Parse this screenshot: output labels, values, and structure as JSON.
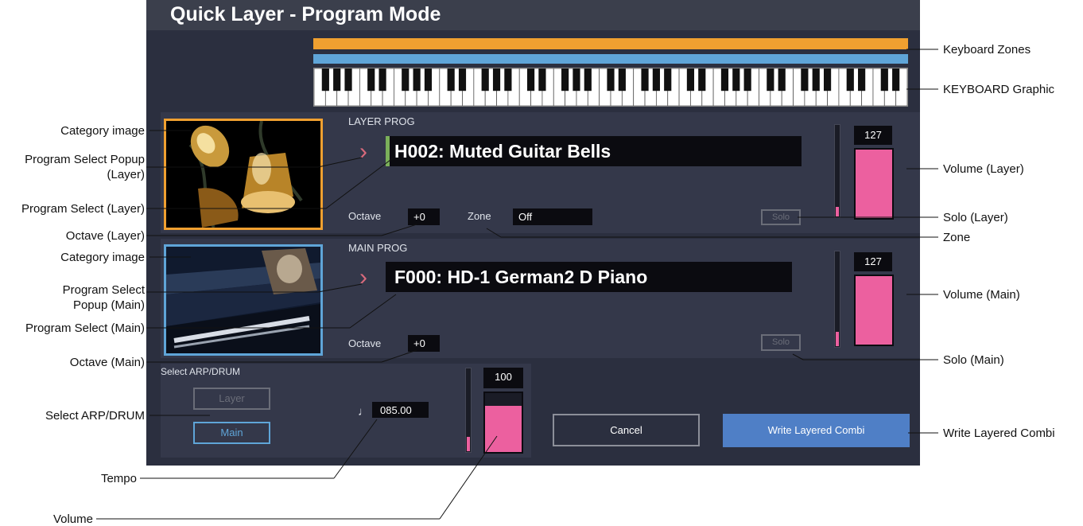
{
  "title": "Quick Layer - Program Mode",
  "layer": {
    "section_label": "LAYER PROG",
    "program": "H002: Muted Guitar Bells",
    "octave_label": "Octave",
    "octave_value": "+0",
    "zone_label": "Zone",
    "zone_value": "Off",
    "solo_label": "Solo",
    "volume": "127",
    "volume_level": 1.0
  },
  "main": {
    "section_label": "MAIN PROG",
    "program": "F000: HD-1 German2 D Piano",
    "octave_label": "Octave",
    "octave_value": "+0",
    "solo_label": "Solo",
    "volume": "127",
    "volume_level": 1.0
  },
  "arp": {
    "section_label": "Select ARP/DRUM",
    "options": [
      "Layer",
      "Main"
    ],
    "selected": "Main"
  },
  "tempo": {
    "icon": "quarter-note-icon",
    "symbol": "♩",
    "value": "085.00"
  },
  "volume": {
    "value": "100",
    "level": 0.79
  },
  "buttons": {
    "cancel": "Cancel",
    "write": "Write Layered Combi"
  },
  "colors": {
    "layer_accent": "#f0a030",
    "main_accent": "#5fa5d8",
    "volume_fill": "#ec609f",
    "write_button": "#4f7fc6"
  },
  "annotations": {
    "keyboard_zones": "Keyboard Zones",
    "keyboard_graphic": "KEYBOARD Graphic",
    "category_image_layer": "Category image",
    "program_select_popup_layer": [
      "Program Select Popup",
      "(Layer)"
    ],
    "program_select_layer": "Program Select (Layer)",
    "octave_layer": "Octave (Layer)",
    "category_image_main": "Category image",
    "program_select_popup_main": [
      "Program Select",
      "Popup (Main)"
    ],
    "program_select_main": "Program Select (Main)",
    "octave_main": "Octave (Main)",
    "select_arp_drum": "Select ARP/DRUM",
    "tempo": "Tempo",
    "volume": "Volume",
    "volume_layer": "Volume (Layer)",
    "solo_layer": "Solo (Layer)",
    "zone": "Zone",
    "volume_main": "Volume (Main)",
    "solo_main": "Solo (Main)",
    "write_layered_combi": "Write Layered Combi"
  }
}
